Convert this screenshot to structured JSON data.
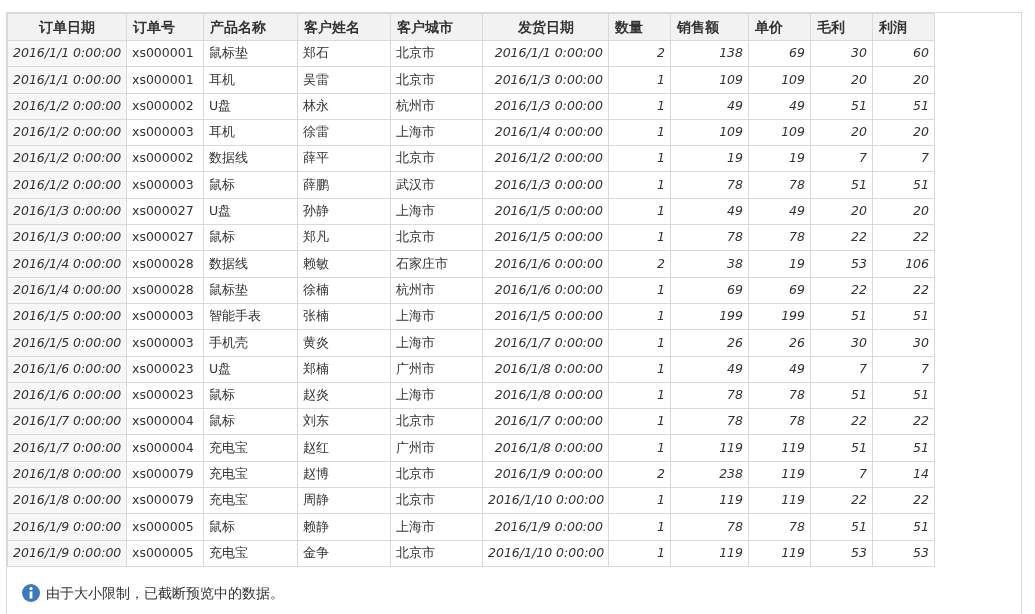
{
  "table": {
    "columns": [
      {
        "label": "订单日期",
        "kind": "date"
      },
      {
        "label": "订单号",
        "kind": "text"
      },
      {
        "label": "产品名称",
        "kind": "text"
      },
      {
        "label": "客户姓名",
        "kind": "text"
      },
      {
        "label": "客户城市",
        "kind": "text"
      },
      {
        "label": "发货日期",
        "kind": "date"
      },
      {
        "label": "数量",
        "kind": "number"
      },
      {
        "label": "销售额",
        "kind": "number"
      },
      {
        "label": "单价",
        "kind": "number"
      },
      {
        "label": "毛利",
        "kind": "number"
      },
      {
        "label": "利润",
        "kind": "number"
      }
    ],
    "rows": [
      [
        "2016/1/1 0:00:00",
        "xs000001",
        "鼠标垫",
        "郑石",
        "北京市",
        "2016/1/1 0:00:00",
        "2",
        "138",
        "69",
        "30",
        "60"
      ],
      [
        "2016/1/1 0:00:00",
        "xs000001",
        "耳机",
        "吴雷",
        "北京市",
        "2016/1/3 0:00:00",
        "1",
        "109",
        "109",
        "20",
        "20"
      ],
      [
        "2016/1/2 0:00:00",
        "xs000002",
        "U盘",
        "林永",
        "杭州市",
        "2016/1/3 0:00:00",
        "1",
        "49",
        "49",
        "51",
        "51"
      ],
      [
        "2016/1/2 0:00:00",
        "xs000003",
        "耳机",
        "徐雷",
        "上海市",
        "2016/1/4 0:00:00",
        "1",
        "109",
        "109",
        "20",
        "20"
      ],
      [
        "2016/1/2 0:00:00",
        "xs000002",
        "数据线",
        "薛平",
        "北京市",
        "2016/1/2 0:00:00",
        "1",
        "19",
        "19",
        "7",
        "7"
      ],
      [
        "2016/1/2 0:00:00",
        "xs000003",
        "鼠标",
        "薛鹏",
        "武汉市",
        "2016/1/3 0:00:00",
        "1",
        "78",
        "78",
        "51",
        "51"
      ],
      [
        "2016/1/3 0:00:00",
        "xs000027",
        "U盘",
        "孙静",
        "上海市",
        "2016/1/5 0:00:00",
        "1",
        "49",
        "49",
        "20",
        "20"
      ],
      [
        "2016/1/3 0:00:00",
        "xs000027",
        "鼠标",
        "郑凡",
        "北京市",
        "2016/1/5 0:00:00",
        "1",
        "78",
        "78",
        "22",
        "22"
      ],
      [
        "2016/1/4 0:00:00",
        "xs000028",
        "数据线",
        "赖敏",
        "石家庄市",
        "2016/1/6 0:00:00",
        "2",
        "38",
        "19",
        "53",
        "106"
      ],
      [
        "2016/1/4 0:00:00",
        "xs000028",
        "鼠标垫",
        "徐楠",
        "杭州市",
        "2016/1/6 0:00:00",
        "1",
        "69",
        "69",
        "22",
        "22"
      ],
      [
        "2016/1/5 0:00:00",
        "xs000003",
        "智能手表",
        "张楠",
        "上海市",
        "2016/1/5 0:00:00",
        "1",
        "199",
        "199",
        "51",
        "51"
      ],
      [
        "2016/1/5 0:00:00",
        "xs000003",
        "手机壳",
        "黄炎",
        "上海市",
        "2016/1/7 0:00:00",
        "1",
        "26",
        "26",
        "30",
        "30"
      ],
      [
        "2016/1/6 0:00:00",
        "xs000023",
        "U盘",
        "郑楠",
        "广州市",
        "2016/1/8 0:00:00",
        "1",
        "49",
        "49",
        "7",
        "7"
      ],
      [
        "2016/1/6 0:00:00",
        "xs000023",
        "鼠标",
        "赵炎",
        "上海市",
        "2016/1/8 0:00:00",
        "1",
        "78",
        "78",
        "51",
        "51"
      ],
      [
        "2016/1/7 0:00:00",
        "xs000004",
        "鼠标",
        "刘东",
        "北京市",
        "2016/1/7 0:00:00",
        "1",
        "78",
        "78",
        "22",
        "22"
      ],
      [
        "2016/1/7 0:00:00",
        "xs000004",
        "充电宝",
        "赵红",
        "广州市",
        "2016/1/8 0:00:00",
        "1",
        "119",
        "119",
        "51",
        "51"
      ],
      [
        "2016/1/8 0:00:00",
        "xs000079",
        "充电宝",
        "赵博",
        "北京市",
        "2016/1/9 0:00:00",
        "2",
        "238",
        "119",
        "7",
        "14"
      ],
      [
        "2016/1/8 0:00:00",
        "xs000079",
        "充电宝",
        "周静",
        "北京市",
        "2016/1/10 0:00:00",
        "1",
        "119",
        "119",
        "22",
        "22"
      ],
      [
        "2016/1/9 0:00:00",
        "xs000005",
        "鼠标",
        "赖静",
        "上海市",
        "2016/1/9 0:00:00",
        "1",
        "78",
        "78",
        "51",
        "51"
      ],
      [
        "2016/1/9 0:00:00",
        "xs000005",
        "充电宝",
        "金争",
        "北京市",
        "2016/1/10 0:00:00",
        "1",
        "119",
        "119",
        "53",
        "53"
      ]
    ]
  },
  "notice": {
    "text": "由于大小限制，已截断预览中的数据。"
  }
}
